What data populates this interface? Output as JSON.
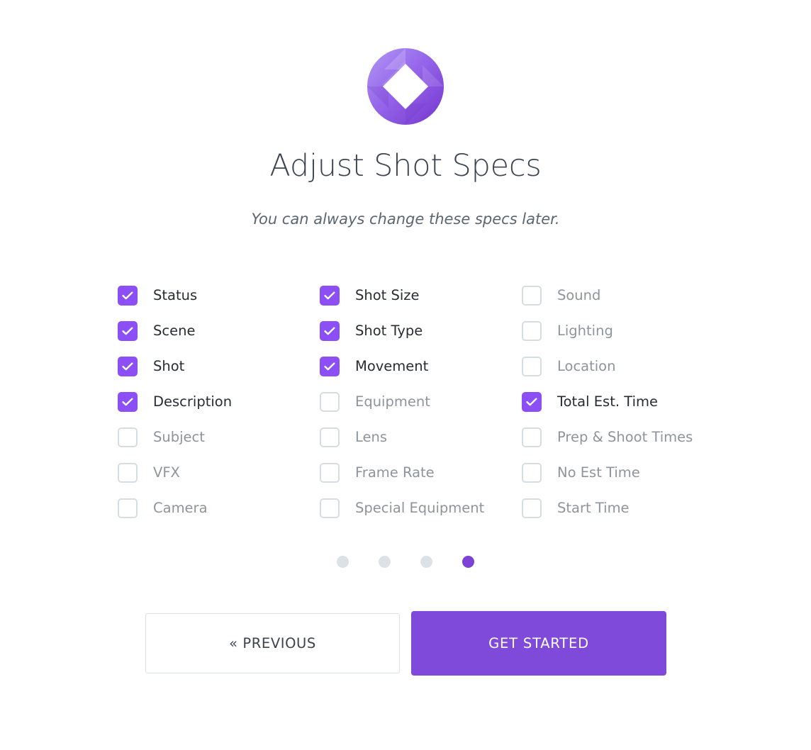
{
  "brand": {
    "logo_icon": "aperture-diamond-logo-icon",
    "gradient_light": "#ab8ef2",
    "gradient_mid": "#9566ea",
    "gradient_dark": "#7a3ed2",
    "accent": "#7f4ada",
    "checkbox_checked": "#8b4ff5"
  },
  "header": {
    "title": "Adjust Shot Specs",
    "subtitle": "You can always change these specs later."
  },
  "columns": [
    {
      "name": "column-1",
      "items": [
        {
          "label": "Status",
          "checked": false
        },
        {
          "label": "Scene",
          "checked": true
        },
        {
          "label": "Shot",
          "checked": true
        },
        {
          "label": "Description",
          "checked": true
        },
        {
          "label": "Subject",
          "checked": false
        },
        {
          "label": "VFX",
          "checked": false
        },
        {
          "label": "Camera",
          "checked": false
        }
      ]
    },
    {
      "name": "column-2",
      "items": [
        {
          "label": "Shot Size",
          "checked": true
        },
        {
          "label": "Shot Type",
          "checked": true
        },
        {
          "label": "Movement",
          "checked": true
        },
        {
          "label": "Equipment",
          "checked": false
        },
        {
          "label": "Lens",
          "checked": false
        },
        {
          "label": "Frame Rate",
          "checked": false
        },
        {
          "label": "Special Equipment",
          "checked": false
        }
      ]
    },
    {
      "name": "column-3",
      "items": [
        {
          "label": "Sound",
          "checked": false
        },
        {
          "label": "Lighting",
          "checked": false
        },
        {
          "label": "Location",
          "checked": false
        },
        {
          "label": "Total Est. Time",
          "checked": true
        },
        {
          "label": "Prep & Shoot Times",
          "checked": false
        },
        {
          "label": "No Est Time",
          "checked": false
        },
        {
          "label": "Start Time",
          "checked": false
        }
      ]
    }
  ],
  "pagination": {
    "total": 4,
    "active_index": 3,
    "inactive_color": "#dce1e5",
    "active_color": "#7d41d6"
  },
  "footer": {
    "previous_label": "« PREVIOUS",
    "get_started_label": "GET STARTED"
  }
}
